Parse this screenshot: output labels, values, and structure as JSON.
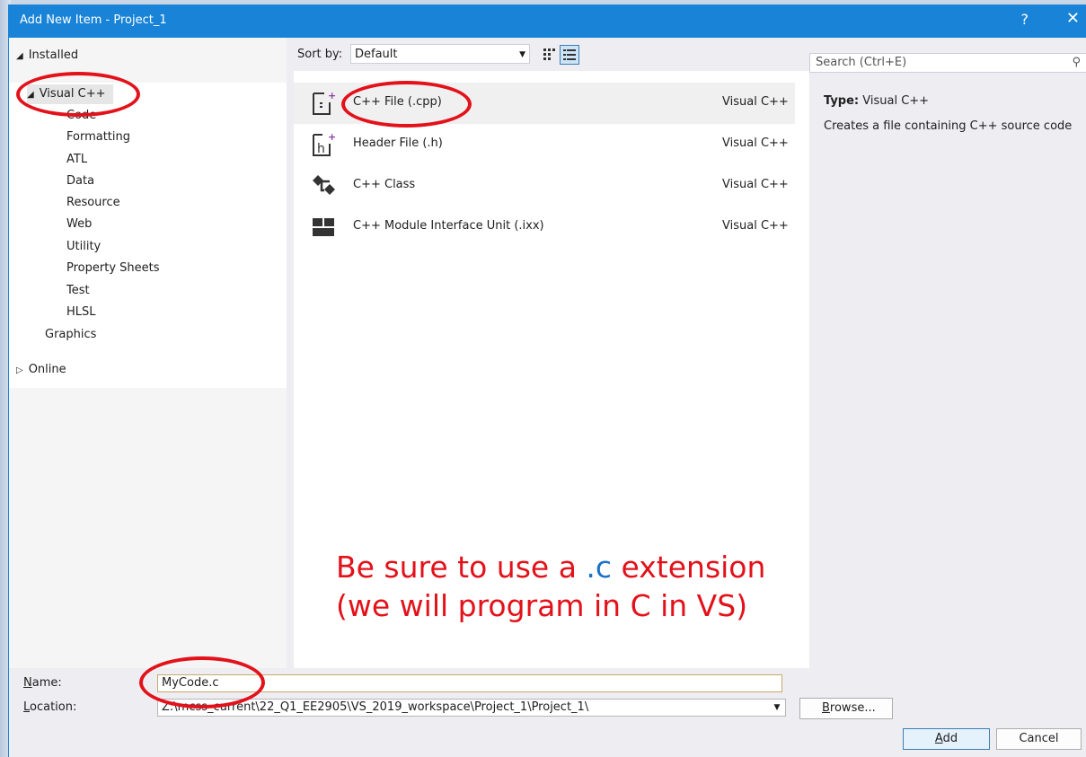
{
  "window": {
    "title": "Add New Item - Project_1",
    "help": "?",
    "close": "✕"
  },
  "left": {
    "installed": "Installed",
    "visual_cpp": "Visual C++",
    "children": [
      "Code",
      "Formatting",
      "ATL",
      "Data",
      "Resource",
      "Web",
      "Utility",
      "Property Sheets",
      "Test",
      "HLSL"
    ],
    "graphics": "Graphics",
    "online": "Online"
  },
  "toolbar": {
    "sort_label": "Sort by:",
    "sort_value": "Default"
  },
  "items": [
    {
      "name": "C++ File (.cpp)",
      "lang": "Visual C++",
      "icon": "cpp-file-icon"
    },
    {
      "name": "Header File (.h)",
      "lang": "Visual C++",
      "icon": "header-file-icon"
    },
    {
      "name": "C++ Class",
      "lang": "Visual C++",
      "icon": "class-icon"
    },
    {
      "name": "C++ Module Interface Unit (.ixx)",
      "lang": "Visual C++",
      "icon": "module-icon"
    }
  ],
  "search": {
    "placeholder": "Search (Ctrl+E)"
  },
  "details": {
    "type_label": "Type:",
    "type_value": "Visual C++",
    "description": "Creates a file containing C++ source code"
  },
  "bottom": {
    "name_label_u": "N",
    "name_label_rest": "ame:",
    "name_value": "MyCode.c",
    "location_label_u": "L",
    "location_label_rest": "ocation:",
    "location_value": "Z:\\mcss_current\\22_Q1_EE2905\\VS_2019_workspace\\Project_1\\Project_1\\",
    "browse_u": "B",
    "browse_rest": "rowse...",
    "add_u": "A",
    "add_rest": "dd",
    "cancel": "Cancel"
  },
  "annotation": {
    "line1_a": "Be sure to use a ",
    "line1_b": ".c",
    "line1_c": " extension",
    "line2": "(we will program in C in VS)"
  },
  "colors": {
    "titlebar": "#1883d7",
    "annotation_red": "#e3111a",
    "annotation_blue": "#1a73c6"
  }
}
